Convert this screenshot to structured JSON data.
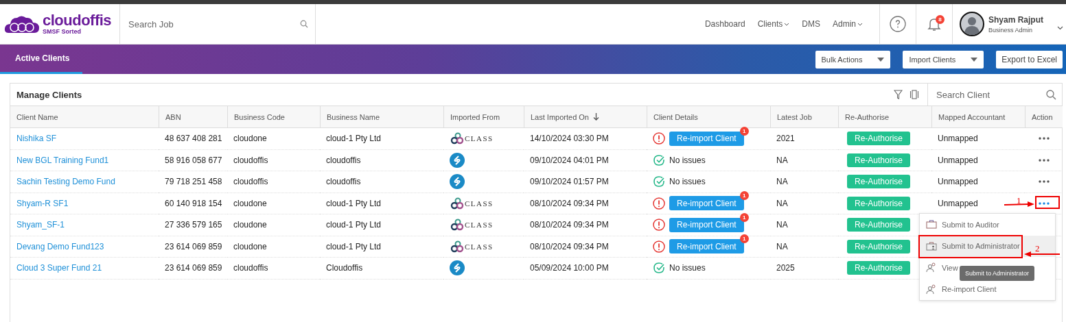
{
  "header": {
    "logo_name": "cloudoffis",
    "logo_tagline": "SMSF Sorted",
    "search": {
      "placeholder": "Search Job"
    },
    "nav": [
      {
        "label": "Dashboard",
        "dropdown": false
      },
      {
        "label": "Clients",
        "dropdown": true
      },
      {
        "label": "DMS",
        "dropdown": false
      },
      {
        "label": "Admin",
        "dropdown": true
      }
    ],
    "notifications": "8",
    "user": {
      "name": "Shyam Rajput",
      "role": "Business Admin"
    }
  },
  "tabs": [
    {
      "label": "Active Clients",
      "selected": true
    }
  ],
  "actions": [
    {
      "label": "Bulk Actions",
      "dropdown": true
    },
    {
      "label": "Import Clients",
      "dropdown": true
    },
    {
      "label": "Export to Excel",
      "dropdown": false
    }
  ],
  "card": {
    "title": "Manage Clients",
    "search": {
      "placeholder": "Search Client"
    }
  },
  "table": {
    "columns": [
      {
        "label": "Client Name",
        "sorted": false
      },
      {
        "label": "ABN",
        "sorted": false
      },
      {
        "label": "Business Code",
        "sorted": false
      },
      {
        "label": "Business Name",
        "sorted": false
      },
      {
        "label": "Imported From",
        "sorted": false
      },
      {
        "label": "Last Imported On",
        "sorted": true
      },
      {
        "label": "Client Details",
        "sorted": false
      },
      {
        "label": "Latest Job",
        "sorted": false
      },
      {
        "label": "Re-Authorise",
        "sorted": false
      },
      {
        "label": "Mapped Accountant",
        "sorted": false
      },
      {
        "label": "Action",
        "sorted": false
      }
    ],
    "rows": [
      {
        "client": "Nishika SF",
        "abn": "48 637 408 281",
        "code": "cloudone",
        "business": "cloud-1 Pty Ltd",
        "source": {
          "kind": "class",
          "label": "CLASS"
        },
        "imported": "14/10/2024 03:30 PM",
        "details": {
          "kind": "issue",
          "label": "Re-import Client",
          "badge": "1"
        },
        "latest_job": "2021",
        "reauthorise": "Re-Authorise",
        "accountant": "Unmapped",
        "menu_open": false
      },
      {
        "client": "New BGL Training Fund1",
        "abn": "58 916 058 677",
        "code": "cloudoffis",
        "business": "cloudoffis",
        "source": {
          "kind": "bgl"
        },
        "imported": "09/10/2024 04:01 PM",
        "details": {
          "kind": "ok",
          "label": "No issues"
        },
        "latest_job": "NA",
        "reauthorise": "Re-Authorise",
        "accountant": "Unmapped",
        "menu_open": false
      },
      {
        "client": "Sachin Testing Demo Fund",
        "abn": "79 718 251 458",
        "code": "cloudoffis",
        "business": "cloudoffis",
        "source": {
          "kind": "bgl"
        },
        "imported": "09/10/2024 01:57 PM",
        "details": {
          "kind": "ok",
          "label": "No issues"
        },
        "latest_job": "NA",
        "reauthorise": "Re-Authorise",
        "accountant": "Unmapped",
        "menu_open": false
      },
      {
        "client": "Shyam-R SF1",
        "abn": "60 140 918 154",
        "code": "cloudone",
        "business": "cloud-1 Pty Ltd",
        "source": {
          "kind": "class",
          "label": "CLASS"
        },
        "imported": "08/10/2024 09:34 PM",
        "details": {
          "kind": "issue",
          "label": "Re-import Client",
          "badge": "1"
        },
        "latest_job": "NA",
        "reauthorise": "Re-Authorise",
        "accountant": "Unmapped",
        "menu_open": true
      },
      {
        "client": "Shyam_SF-1",
        "abn": "27 336 579 165",
        "code": "cloudone",
        "business": "cloud-1 Pty Ltd",
        "source": {
          "kind": "class",
          "label": "CLASS"
        },
        "imported": "08/10/2024 09:34 PM",
        "details": {
          "kind": "issue",
          "label": "Re-import Client",
          "badge": "1"
        },
        "latest_job": "NA",
        "reauthorise": "Re-Authorise"
      },
      {
        "client": "Devang Demo Fund123",
        "abn": "23 614 069 859",
        "code": "cloudone",
        "business": "cloud-1 Pty Ltd",
        "source": {
          "kind": "class",
          "label": "CLASS"
        },
        "imported": "08/10/2024 09:34 PM",
        "details": {
          "kind": "issue",
          "label": "Re-import Client",
          "badge": "1"
        },
        "latest_job": "NA",
        "reauthorise": "Re-Authorise"
      },
      {
        "client": "Cloud 3 Super Fund 21",
        "abn": "23 614 069 859",
        "code": "cloudoffis",
        "business": "Cloudoffis",
        "source": {
          "kind": "bgl"
        },
        "imported": "05/09/2024 10:00 PM",
        "details": {
          "kind": "ok",
          "label": "No issues"
        },
        "latest_job": "2025",
        "reauthorise": "Re-Authorise"
      }
    ]
  },
  "row_menu": {
    "items": [
      {
        "kind": "briefcase",
        "label": "Submit to Auditor",
        "selected": false
      },
      {
        "kind": "briefcase-person",
        "label": "Submit to Administrator",
        "selected": true
      },
      {
        "kind": "people",
        "label": "View",
        "selected": false
      },
      {
        "kind": "people",
        "label": "Re-import Client",
        "selected": false
      }
    ],
    "tooltip": "Submit to Administrator"
  },
  "annotations": [
    {
      "label": "1"
    },
    {
      "label": "2"
    }
  ]
}
